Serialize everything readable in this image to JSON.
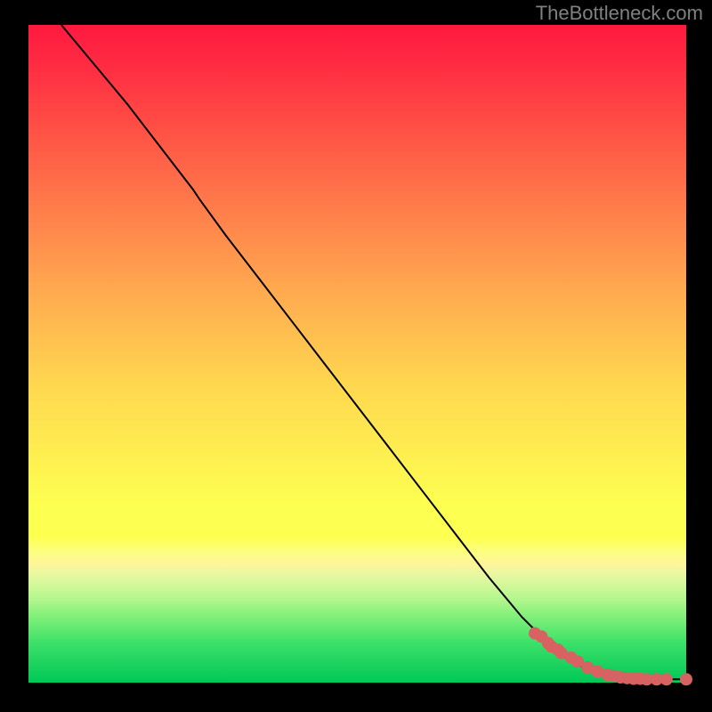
{
  "attribution": "TheBottleneck.com",
  "chart_data": {
    "type": "line",
    "title": "",
    "xlabel": "",
    "ylabel": "",
    "xlim": [
      0,
      100
    ],
    "ylim": [
      0,
      100
    ],
    "series": [
      {
        "name": "curve",
        "style": "line",
        "color": "#000000",
        "x": [
          5,
          10,
          15,
          20,
          25,
          26,
          30,
          35,
          40,
          45,
          50,
          55,
          60,
          65,
          70,
          75,
          80,
          82,
          85,
          88,
          90,
          92,
          94,
          96,
          98,
          100
        ],
        "y": [
          100,
          94,
          88,
          81.5,
          75,
          73.5,
          68,
          61.5,
          55,
          48.5,
          42,
          35.5,
          29,
          22.5,
          16,
          10,
          5,
          3.5,
          2,
          1.2,
          0.8,
          0.6,
          0.5,
          0.5,
          0.5,
          0.5
        ]
      },
      {
        "name": "points",
        "style": "scatter",
        "color": "#d86262",
        "x": [
          77,
          78,
          79,
          79.5,
          80.5,
          81,
          82.5,
          83.5,
          85,
          86.5,
          88,
          89,
          90,
          91,
          92,
          93,
          94,
          95.5,
          97,
          100
        ],
        "y": [
          7.5,
          7,
          6,
          5.5,
          5,
          4.5,
          3.8,
          3.2,
          2.3,
          1.7,
          1.2,
          1,
          0.8,
          0.7,
          0.6,
          0.6,
          0.5,
          0.5,
          0.5,
          0.5
        ]
      }
    ]
  }
}
